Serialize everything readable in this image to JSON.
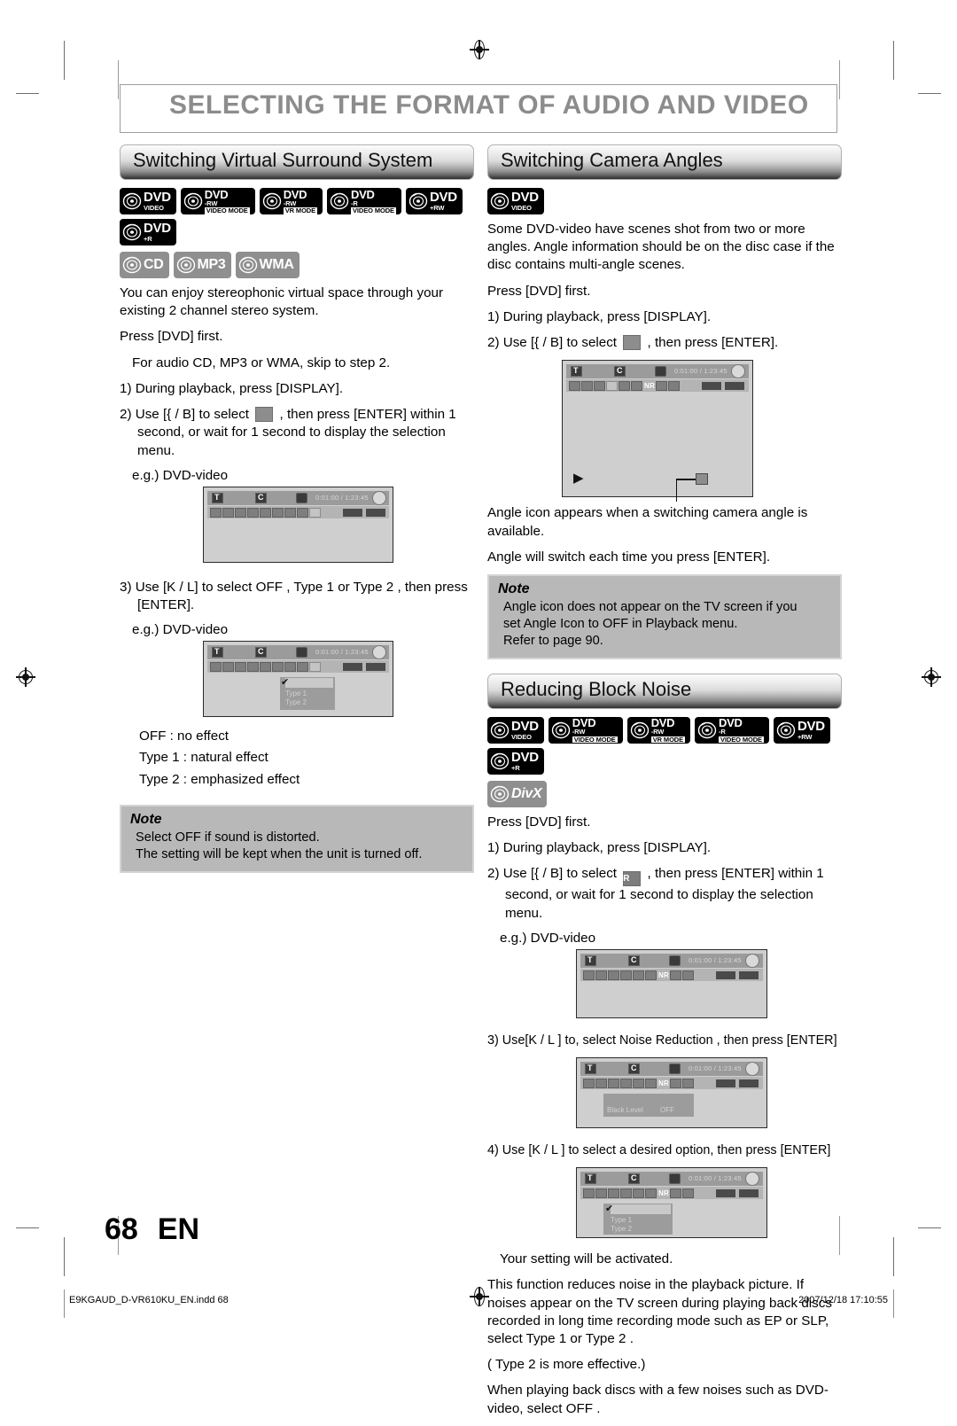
{
  "page": {
    "title": "SELECTING THE FORMAT OF AUDIO AND VIDEO",
    "number": "68",
    "lang": "EN",
    "footer_left": "E9KGAUD_D-VR610KU_EN.indd   68",
    "footer_right": "2007/12/18   17:10:55"
  },
  "badges": {
    "dvd_video": {
      "t1": "DVD",
      "t2": "Video"
    },
    "dvd_rw_video": {
      "t1": "DVD",
      "t2": "-RW",
      "t3": "Video Mode"
    },
    "dvd_rw_vr": {
      "t1": "DVD",
      "t2": "-RW",
      "t3": "VR MODE"
    },
    "dvd_r_video": {
      "t1": "DVD",
      "t2": "-R",
      "t3": "Video Mode"
    },
    "dvd_plus_rw": {
      "t1": "DVD",
      "t2": "+RW"
    },
    "dvd_plus_r": {
      "t1": "DVD",
      "t2": "+R"
    },
    "cd": {
      "t1": "CD"
    },
    "mp3": {
      "t1": "MP3"
    },
    "wma": {
      "t1": "WMA"
    },
    "divx": {
      "t1": "DivX"
    }
  },
  "osd": {
    "time": "0:01:00 / 1:23:45",
    "label_t": "T",
    "label_c": "C",
    "label_nr": "NR",
    "menu_rows": [
      "Type 1",
      "Type 2"
    ],
    "black_level_label": "Black Level",
    "black_level_value": "OFF"
  },
  "left": {
    "heading": "Switching Virtual Surround System",
    "intro": "You can enjoy stereophonic virtual space through your existing 2 channel stereo system.",
    "press_dvd": "Press [DVD] first.",
    "skip_note": "For audio CD, MP3 or WMA, skip to step 2.",
    "step1": "1) During playback, press [DISPLAY].",
    "step2_a": "2) Use [{ / B] to select",
    "step2_b": ", then press [ENTER] within 1 second, or wait for 1 second to display the selection menu.",
    "eg1": "e.g.) DVD-video",
    "step3": "3) Use [K / L] to select  OFF ,  Type 1  or  Type 2 , then press [ENTER].",
    "eg2": "e.g.) DVD-video",
    "opt_off": "OFF       : no effect",
    "opt_t1": "Type 1  : natural effect",
    "opt_t2": "Type 2  : emphasized effect",
    "note_title": "Note",
    "note_line1": "Select  OFF  if sound is distorted.",
    "note_line2": "The setting will be kept when the unit is turned off."
  },
  "right": {
    "angles": {
      "heading": "Switching Camera Angles",
      "intro": "Some DVD-video have scenes shot from two or more angles. Angle information should be on the disc case if the disc contains multi-angle scenes.",
      "press_dvd": "Press [DVD] first.",
      "step1": "1) During playback, press [DISPLAY].",
      "step2_a": "2) Use [{ / B] to select",
      "step2_b": ", then press [ENTER].",
      "after1": "Angle icon appears when a switching camera angle is available.",
      "after2": "Angle will switch each time you press [ENTER].",
      "note_title": "Note",
      "note_line1": "Angle icon does not appear on the TV screen if you",
      "note_line2": "set  Angle Icon  to  OFF  in  Playback  menu.",
      "note_line3": "Refer to page 90."
    },
    "noise": {
      "heading": "Reducing Block Noise",
      "press_dvd": "Press [DVD] first.",
      "step1": "1) During playback, press [DISPLAY].",
      "step2_a": "2) Use [{ / B] to select",
      "step2_b": ", then press [ENTER] within 1 second, or wait for 1 second to display the selection menu.",
      "eg1": "e.g.) DVD-video",
      "step3": "3) Use[K / L ] to, select  Noise Reduction , then press [ENTER]",
      "step4": "4) Use [K / L ] to select a desired option, then press [ENTER]",
      "activated": "Your setting will be activated.",
      "para1": "This function reduces noise in the playback picture. If noises appear on the TV screen during playing back discs recorded in long time recording mode such as EP or SLP, select  Type 1  or  Type 2 .",
      "para2": "( Type 2  is more effective.)",
      "para3": "When playing back discs with a few noises such as DVD-video, select  OFF ."
    }
  }
}
